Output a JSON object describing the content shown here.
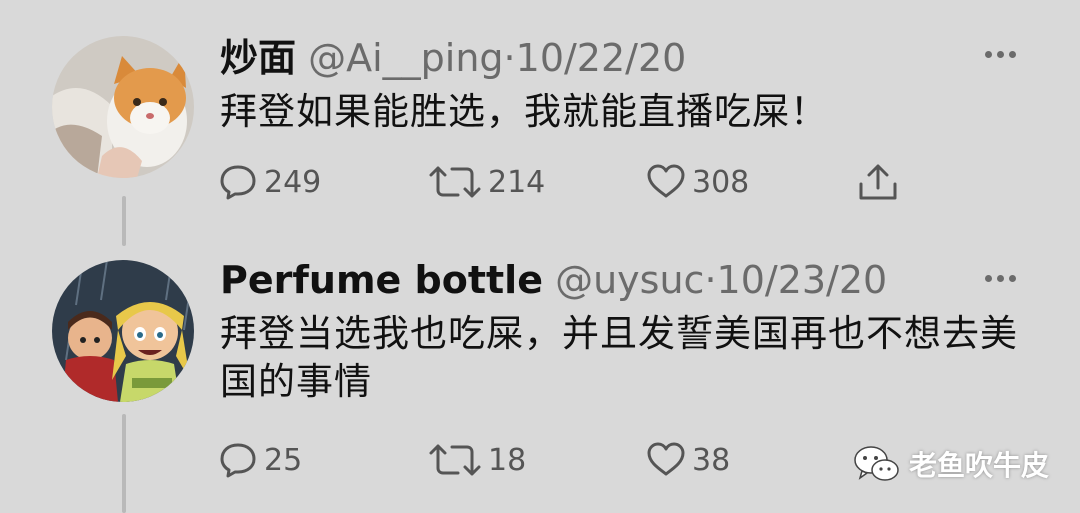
{
  "tweets": [
    {
      "author": "炒面",
      "handle": "@Ai__ping",
      "separator": "·",
      "date": "10/22/20",
      "text": "拜登如果能胜选，我就能直播吃屎！",
      "replies": "249",
      "retweets": "214",
      "likes": "308",
      "avatar_icon": "cat-avatar"
    },
    {
      "author": "Perfume bottle",
      "handle": "@uysuc",
      "separator": "·",
      "date": "10/23/20",
      "text": "拜登当选我也吃屎，并且发誓美国再也不想去美国的事情",
      "replies": "25",
      "retweets": "18",
      "likes": "38",
      "avatar_icon": "cartoon-avatar"
    }
  ],
  "icons": {
    "reply": "reply-icon",
    "retweet": "retweet-icon",
    "like": "heart-icon",
    "share": "share-icon",
    "more": "more-options-icon"
  },
  "watermark": {
    "text": "老鱼吹牛皮",
    "icon": "wechat-icon"
  },
  "colors": {
    "background": "#d9d9d9",
    "text": "#111111",
    "secondary": "#6b6b6b",
    "thread_line": "#b9b9b9"
  }
}
